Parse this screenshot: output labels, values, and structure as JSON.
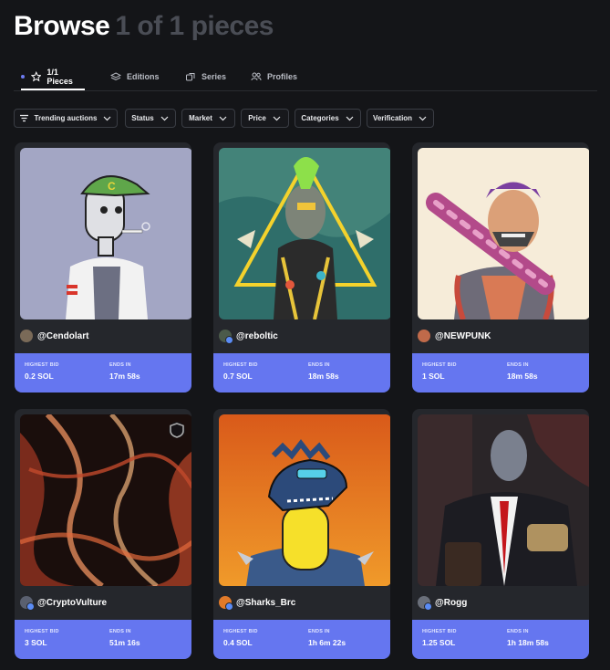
{
  "header": {
    "title": "Browse",
    "count": "1 of 1 pieces"
  },
  "tabs": [
    {
      "label": "1/1 Pieces",
      "icon": "star-icon",
      "active": true
    },
    {
      "label": "Editions",
      "icon": "stack-icon",
      "active": false
    },
    {
      "label": "Series",
      "icon": "series-icon",
      "active": false
    },
    {
      "label": "Profiles",
      "icon": "profiles-icon",
      "active": false
    }
  ],
  "filters": [
    {
      "label": "Trending auctions",
      "icon": "sort-icon"
    },
    {
      "label": "Status"
    },
    {
      "label": "Market"
    },
    {
      "label": "Price"
    },
    {
      "label": "Categories"
    },
    {
      "label": "Verification"
    }
  ],
  "cards": [
    {
      "creator": "@Cendolart",
      "bid_label": "HIGHEST BID",
      "bid": "0.2 SOL",
      "ends_label": "ENDS IN",
      "ends": "17m 58s",
      "verified": false,
      "avatar_color": "#7a6a58"
    },
    {
      "creator": "@reboltic",
      "bid_label": "HIGHEST BID",
      "bid": "0.7 SOL",
      "ends_label": "ENDS IN",
      "ends": "18m 58s",
      "verified": true,
      "avatar_color": "#4b5a4a"
    },
    {
      "creator": "@NEWPUNK",
      "bid_label": "HIGHEST BID",
      "bid": "1 SOL",
      "ends_label": "ENDS IN",
      "ends": "18m 58s",
      "verified": false,
      "avatar_color": "#c06a4a"
    },
    {
      "creator": "@CryptoVulture",
      "bid_label": "HIGHEST BID",
      "bid": "3 SOL",
      "ends_label": "ENDS IN",
      "ends": "51m 16s",
      "verified": true,
      "avatar_color": "#5a6070"
    },
    {
      "creator": "@Sharks_Brc",
      "bid_label": "HIGHEST BID",
      "bid": "0.4 SOL",
      "ends_label": "ENDS IN",
      "ends": "1h 6m 22s",
      "verified": true,
      "avatar_color": "#e07a2a"
    },
    {
      "creator": "@Rogg",
      "bid_label": "HIGHEST BID",
      "bid": "1.25 SOL",
      "ends_label": "ENDS IN",
      "ends": "1h 18m 58s",
      "verified": true,
      "avatar_color": "#6a6f7a"
    }
  ],
  "colors": {
    "accent": "#6576f0",
    "background": "#141518",
    "card": "#25272c"
  }
}
